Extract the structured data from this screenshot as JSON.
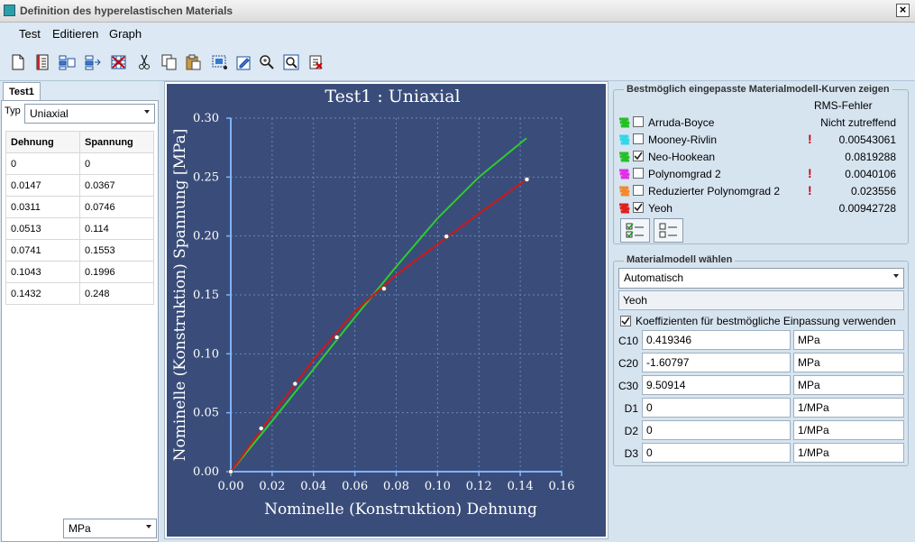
{
  "window": {
    "title": "Definition des hyperelastischen Materials"
  },
  "menu": [
    "Test",
    "Editieren",
    "Graph"
  ],
  "toolbar": [
    "new-icon",
    "table-icon",
    "insert-row-icon",
    "append-row-icon",
    "delete-icon",
    "cut-icon",
    "copy-icon",
    "paste-icon",
    "select-all-icon",
    "edit-icon",
    "zoom-in-icon",
    "zoom-fit-icon",
    "clear-icon"
  ],
  "left": {
    "tab": "Test1",
    "typ_label": "Typ",
    "typ_value": "Uniaxial",
    "columns": [
      "Dehnung",
      "Spannung"
    ],
    "rows": [
      [
        "0",
        "0"
      ],
      [
        "0.0147",
        "0.0367"
      ],
      [
        "0.0311",
        "0.0746"
      ],
      [
        "0.0513",
        "0.114"
      ],
      [
        "0.0741",
        "0.1553"
      ],
      [
        "0.1043",
        "0.1996"
      ],
      [
        "0.1432",
        "0.248"
      ]
    ],
    "unit": "MPa"
  },
  "chart_data": {
    "type": "line",
    "title": "Test1 : Uniaxial",
    "xlabel": "Nominelle (Konstruktion) Dehnung",
    "ylabel": "Nominelle (Konstruktion) Spannung [MPa]",
    "xlim": [
      0,
      0.16
    ],
    "ylim": [
      0,
      0.3
    ],
    "xticks": [
      "0.00",
      "0.02",
      "0.04",
      "0.06",
      "0.08",
      "0.10",
      "0.12",
      "0.14",
      "0.16"
    ],
    "yticks": [
      "0.00",
      "0.05",
      "0.10",
      "0.15",
      "0.20",
      "0.25",
      "0.30"
    ],
    "grid": true,
    "points": {
      "x": [
        0,
        0.0147,
        0.0311,
        0.0513,
        0.0741,
        0.1043,
        0.1432
      ],
      "y": [
        0,
        0.0367,
        0.0746,
        0.114,
        0.1553,
        0.1996,
        0.248
      ]
    },
    "series": [
      {
        "color": "#2ecc2e",
        "x": [
          0,
          0.02,
          0.04,
          0.06,
          0.08,
          0.1,
          0.12,
          0.143
        ],
        "y": [
          0,
          0.043,
          0.087,
          0.131,
          0.174,
          0.215,
          0.25,
          0.283
        ]
      },
      {
        "color": "#d01818",
        "x": [
          0,
          0.02,
          0.04,
          0.06,
          0.08,
          0.1,
          0.12,
          0.143
        ],
        "y": [
          0,
          0.048,
          0.095,
          0.136,
          0.167,
          0.193,
          0.219,
          0.248
        ]
      }
    ],
    "colors": {
      "background": "#3a4d7a",
      "axis": "#7fb4ff",
      "grid": "#6a86b8",
      "text": "#ffffff"
    }
  },
  "right": {
    "fit_group_title": "Bestmöglich eingepasste Materialmodell-Kurven zeigen",
    "rms_header": "RMS-Fehler",
    "models": [
      {
        "name": "Arruda-Boyce",
        "color": "#26c026",
        "checked": false,
        "rms": "Nicht zutreffend",
        "warn": false
      },
      {
        "name": "Mooney-Rivlin",
        "color": "#30d8e8",
        "checked": false,
        "rms": "0.00543061",
        "warn": true
      },
      {
        "name": "Neo-Hookean",
        "color": "#26c026",
        "checked": true,
        "rms": "0.0819288",
        "warn": false
      },
      {
        "name": "Polynomgrad 2",
        "color": "#e030e8",
        "checked": false,
        "rms": "0.0040106",
        "warn": true
      },
      {
        "name": "Reduzierter Polynomgrad 2",
        "color": "#f08a30",
        "checked": false,
        "rms": "0.023556",
        "warn": true
      },
      {
        "name": "Yeoh",
        "color": "#e02020",
        "checked": true,
        "rms": "0.00942728",
        "warn": false
      }
    ],
    "select_group_title": "Materialmodell wählen",
    "mode": "Automatisch",
    "model": "Yeoh",
    "best_fit_label": "Koeffizienten für bestmögliche Einpassung verwenden",
    "coefficients": [
      {
        "label": "C10",
        "value": "0.419346",
        "unit": "MPa"
      },
      {
        "label": "C20",
        "value": "-1.60797",
        "unit": "MPa"
      },
      {
        "label": "C30",
        "value": "9.50914",
        "unit": "MPa"
      },
      {
        "label": "D1",
        "value": "0",
        "unit": "1/MPa"
      },
      {
        "label": "D2",
        "value": "0",
        "unit": "1/MPa"
      },
      {
        "label": "D3",
        "value": "0",
        "unit": "1/MPa"
      }
    ]
  }
}
